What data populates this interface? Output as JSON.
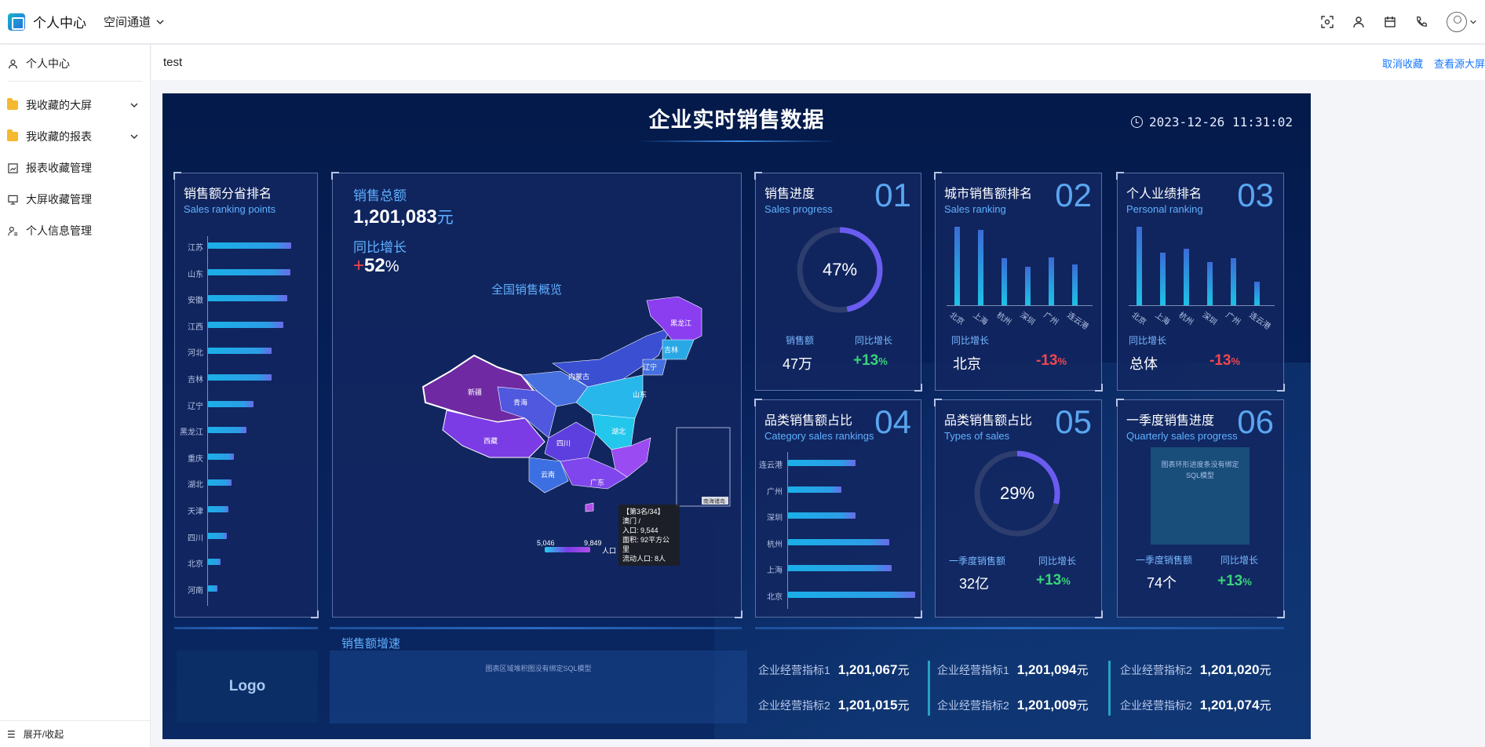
{
  "app": {
    "title": "个人中心",
    "space_nav": "空间通道"
  },
  "top_icons": [
    "scan-icon",
    "user-icon",
    "calendar-icon",
    "phone-icon",
    "avatar-icon"
  ],
  "sidebar": {
    "items": [
      {
        "label": "个人中心",
        "icon": "user-icon"
      },
      {
        "label": "我收藏的大屏",
        "icon": "folder-icon"
      },
      {
        "label": "我收藏的报表",
        "icon": "folder-icon"
      },
      {
        "label": "报表收藏管理",
        "icon": "report-icon"
      },
      {
        "label": "大屏收藏管理",
        "icon": "monitor-icon"
      },
      {
        "label": "个人信息管理",
        "icon": "user-settings-icon"
      }
    ],
    "footer": "展开/收起"
  },
  "content": {
    "title": "test",
    "unfavorite": "取消收藏",
    "view_source": "查看源大屏"
  },
  "dashboard": {
    "title": "企业实时销售数据",
    "datetime": "2023-12-26 11:31:02",
    "province_rank": {
      "title": "销售额分省排名",
      "subtitle": "Sales ranking points",
      "chart_data": {
        "type": "bar",
        "categories": [
          "江苏",
          "山东",
          "安徽",
          "江西",
          "河北",
          "吉林",
          "辽宁",
          "黑龙江",
          "重庆",
          "湖北",
          "天津",
          "四川",
          "北京",
          "河南"
        ],
        "values": [
          108,
          107,
          103,
          98,
          82,
          82,
          59,
          50,
          34,
          31,
          26,
          24,
          16,
          12
        ]
      }
    },
    "total": {
      "label": "销售总额",
      "value": "1,201,083",
      "unit": "元",
      "yoy_label": "同比增长",
      "yoy_sign": "+",
      "yoy_value": "52",
      "yoy_unit": "%",
      "map_title": "全国销售概览",
      "tooltip": {
        "l1": "【第3名/34】",
        "l2": "澳门  /",
        "l3": "入口: 9,544",
        "l4": "面积: 92平方公里",
        "l5": "流动人口: 8人"
      },
      "legend": {
        "min": "5,046",
        "max": "9,849",
        "label": "人口"
      }
    },
    "p01": {
      "title": "销售进度",
      "subtitle": "Sales progress",
      "num": "01",
      "percent": "47%",
      "progress": 0.47,
      "k1_label": "销售额",
      "k1_value": "47万",
      "k2_label": "同比增长",
      "k2_value": "+13",
      "k2_unit": "%"
    },
    "p02": {
      "title": "城市销售额排名",
      "subtitle": "Sales ranking",
      "num": "02",
      "chart_data": {
        "type": "bar",
        "categories": [
          "北京",
          "上海",
          "杭州",
          "深圳",
          "广州",
          "连云港"
        ],
        "values": [
          100,
          96,
          60,
          49,
          61,
          52
        ]
      },
      "k_label": "同比增长",
      "city": "北京",
      "pct": "-13",
      "pct_unit": "%"
    },
    "p03": {
      "title": "个人业绩排名",
      "subtitle": "Personal ranking",
      "num": "03",
      "chart_data": {
        "type": "bar",
        "categories": [
          "北京",
          "上海",
          "杭州",
          "深圳",
          "广州",
          "连云港"
        ],
        "values": [
          100,
          67,
          72,
          55,
          60,
          30
        ]
      },
      "k_label": "同比增长",
      "name": "总体",
      "pct": "-13",
      "pct_unit": "%"
    },
    "p04": {
      "title": "品类销售额占比",
      "subtitle": "Category sales rankings",
      "num": "04",
      "chart_data": {
        "type": "bar",
        "categories": [
          "连云港",
          "广州",
          "深圳",
          "杭州",
          "上海",
          "北京"
        ],
        "values": [
          52,
          41,
          52,
          78,
          80,
          98
        ]
      }
    },
    "p05": {
      "title": "品类销售额占比",
      "subtitle": "Types of sales",
      "num": "05",
      "percent": "29%",
      "progress": 0.29,
      "k1_label": "一季度销售额",
      "k1_value": "32亿",
      "k2_label": "同比增长",
      "k2_value": "+13",
      "k2_unit": "%"
    },
    "p06": {
      "title": "一季度销售进度",
      "subtitle": "Quarterly sales progress",
      "num": "06",
      "placeholder": "图表环形进度条没有绑定SQL模型",
      "k1_label": "一季度销售额",
      "k1_value": "74个",
      "k2_label": "同比增长",
      "k2_value": "+13",
      "k2_unit": "%"
    },
    "bottom": {
      "logo": "Logo",
      "growth_title": "销售额增速",
      "growth_placeholder": "图表区域堆积图没有绑定SQL模型",
      "metrics": [
        {
          "label": "企业经营指标1",
          "value": "1,201,067",
          "unit": "元"
        },
        {
          "label": "企业经营指标2",
          "value": "1,201,015",
          "unit": "元"
        },
        {
          "label": "企业经营指标1",
          "value": "1,201,094",
          "unit": "元"
        },
        {
          "label": "企业经营指标2",
          "value": "1,201,009",
          "unit": "元"
        },
        {
          "label": "企业经营指标2",
          "value": "1,201,020",
          "unit": "元"
        },
        {
          "label": "企业经营指标2",
          "value": "1,201,074",
          "unit": "元"
        }
      ]
    },
    "colors": {
      "bg": "#031a4a",
      "accent": "#5fb0ff",
      "up": "#38d47a",
      "down": "#f0474f",
      "ring": "#6a5cf0"
    }
  }
}
